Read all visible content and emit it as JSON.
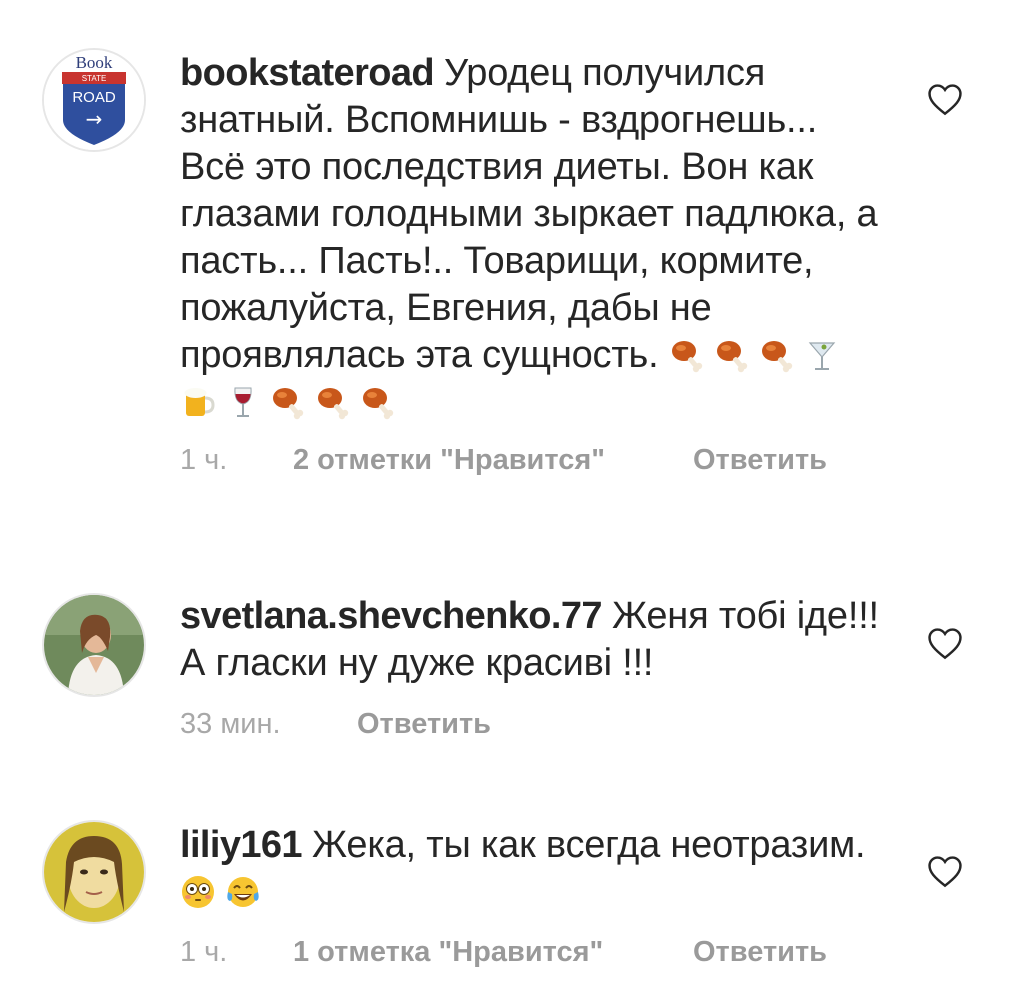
{
  "comments": [
    {
      "username": "bookstateroad",
      "text": "Уродец получился знатный. Вспомнишь - вздрогнешь... Всё это последствия диеты. Вон как глазами голодными зыркает падлюка, а пасть... Пасть!.. Товарищи, кормите, пожалуйста, Евгения, дабы не проявлялась эта сущность.",
      "avatar": {
        "top_text": "Book",
        "sign_small": "STATE",
        "sign_big": "ROAD",
        "arrow": "→"
      },
      "emojis": [
        "poultry-leg-emoji",
        "poultry-leg-emoji",
        "poultry-leg-emoji",
        "cocktail-emoji",
        "beer-mug-emoji",
        "wine-glass-emoji",
        "poultry-leg-emoji",
        "poultry-leg-emoji",
        "poultry-leg-emoji"
      ],
      "time": "1 ч.",
      "likes": "2 отметки \"Нравится\"",
      "reply": "Ответить"
    },
    {
      "username": "svetlana.shevchenko.77",
      "text": "Женя тобі іде!!! А гласки ну дуже красиві !!!",
      "time": "33 мин.",
      "reply": "Ответить"
    },
    {
      "username": "liliy161",
      "text": "Жека, ты как всегда неотразим.",
      "emojis": [
        "flushed-face-emoji",
        "tears-of-joy-emoji"
      ],
      "time": "1 ч.",
      "likes": "1 отметка \"Нравится\"",
      "reply": "Ответить"
    }
  ],
  "colors": {
    "text": "#262626",
    "meta": "#a8a8a8",
    "sign_blue": "#2f4f9e",
    "sign_red": "#c8342f"
  }
}
